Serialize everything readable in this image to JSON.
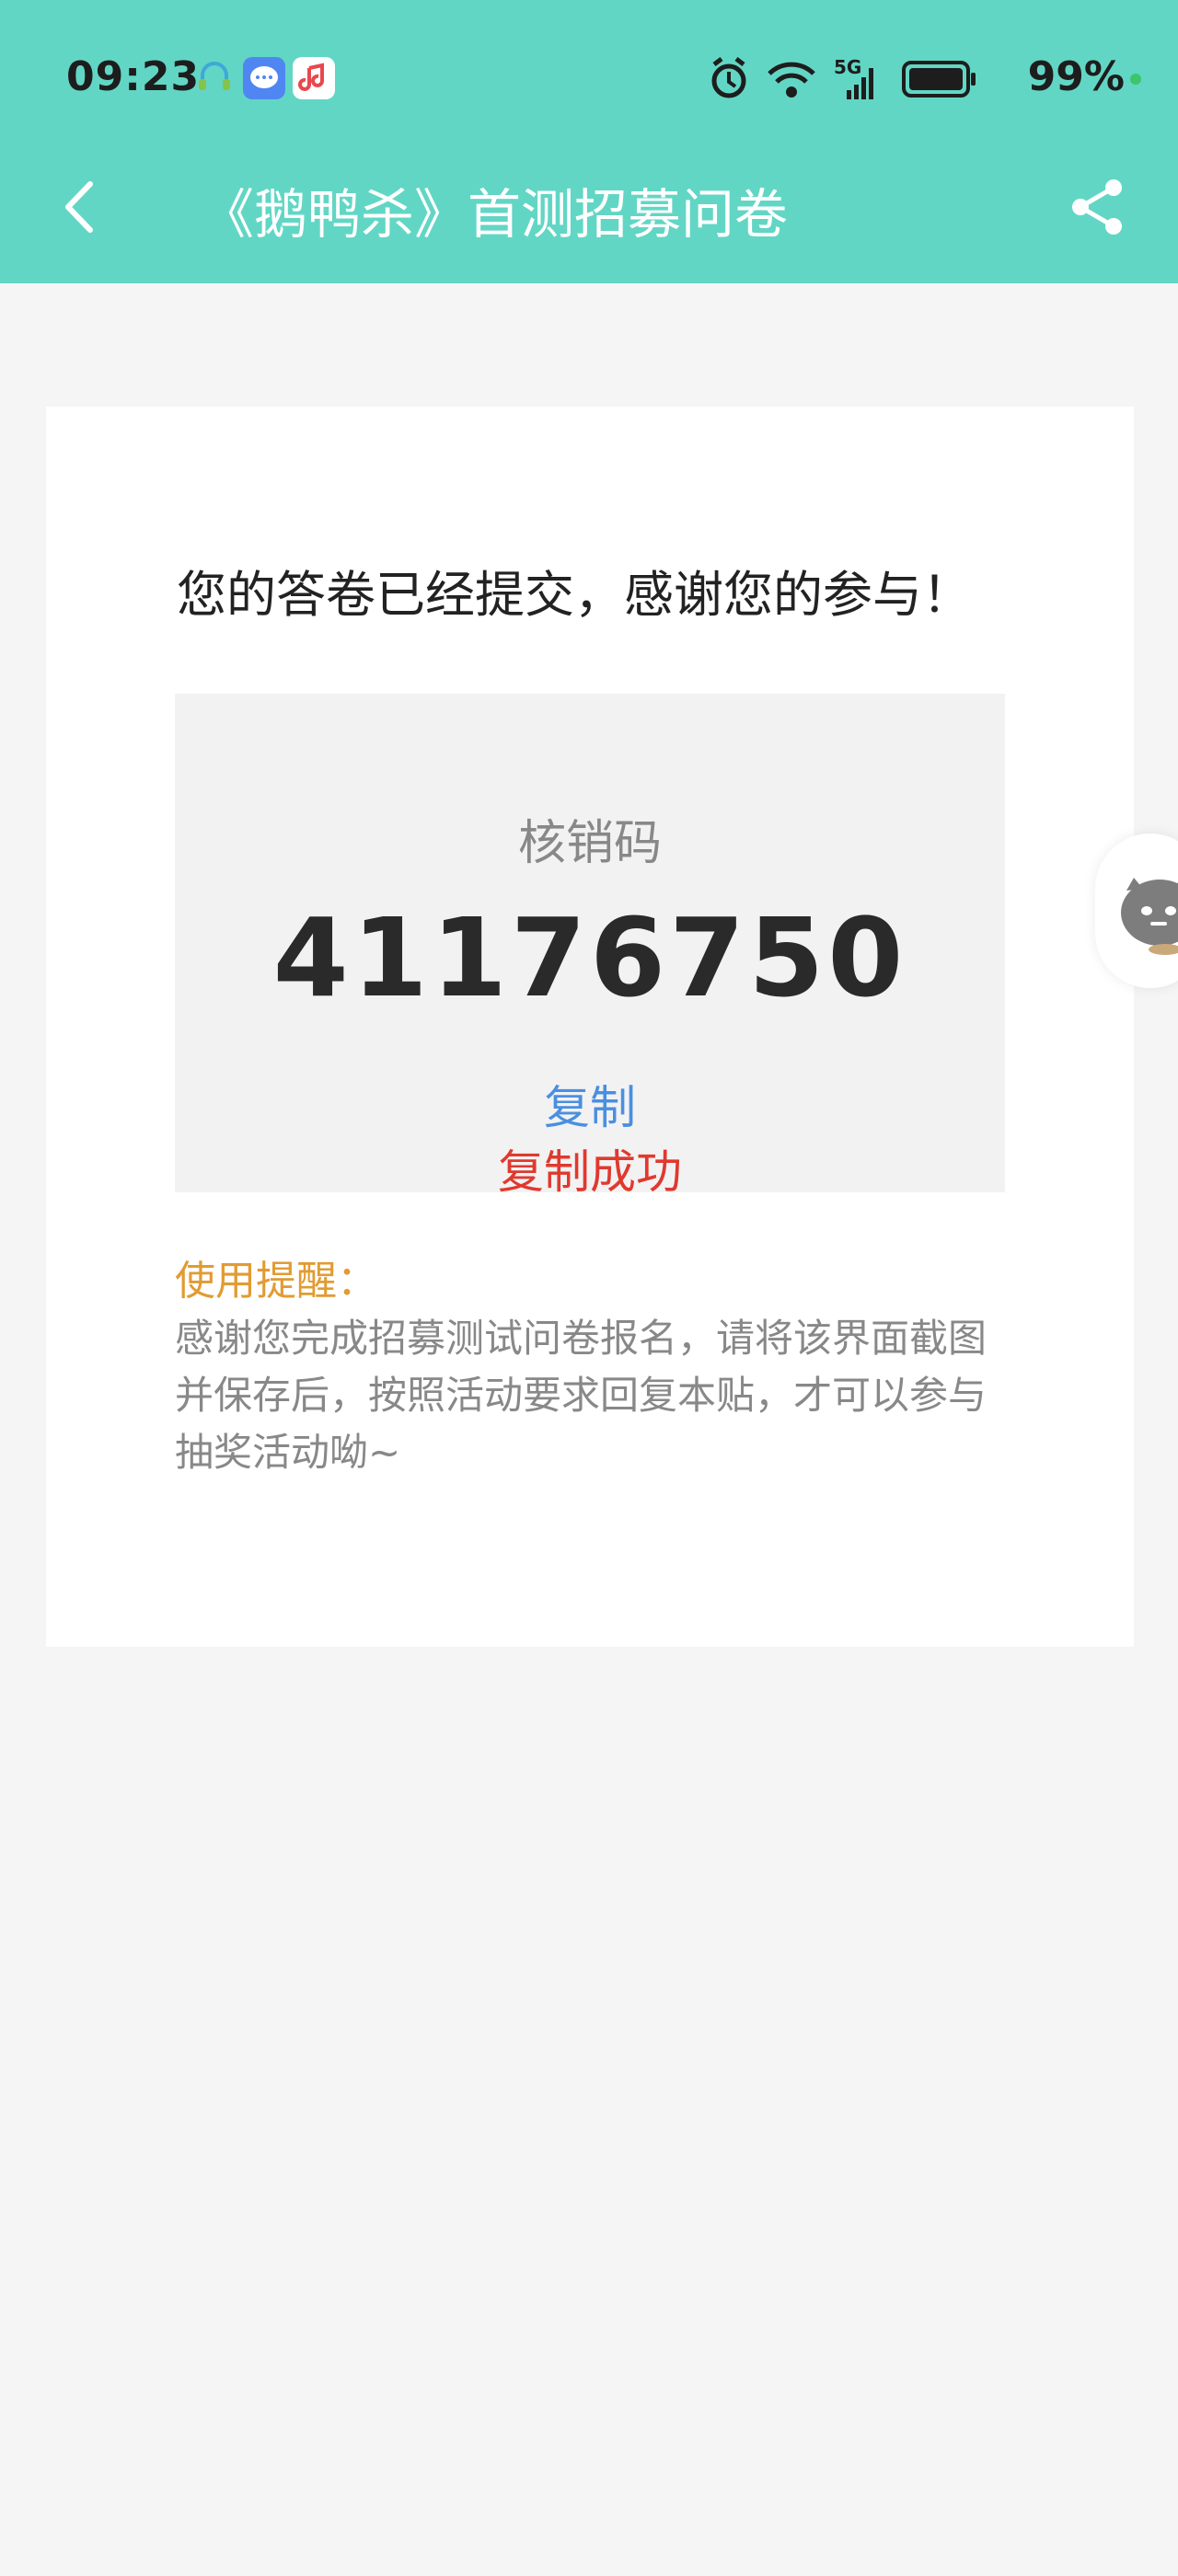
{
  "status_bar": {
    "time": "09:23",
    "battery_percent": "99%",
    "icons": [
      "headset-icon",
      "chat-icon",
      "music-icon",
      "alarm-icon",
      "wifi-icon",
      "signal-5g-icon",
      "battery-icon"
    ]
  },
  "nav": {
    "title": "《鹅鸭杀》首测招募问卷",
    "colors": {
      "bar": "#62d6c4",
      "title": "#ffffff"
    }
  },
  "card": {
    "thanks_text": "您的答卷已经提交，感谢您的参与！",
    "code_label": "核销码",
    "code_value": "41176750",
    "copy_label": "复制",
    "copy_success": "复制成功",
    "tip_title": "使用提醒：",
    "tip_body": "感谢您完成招募测试问卷报名，请将该界面截图并保存后，按照活动要求回复本贴，才可以参与抽奖活动呦~"
  }
}
